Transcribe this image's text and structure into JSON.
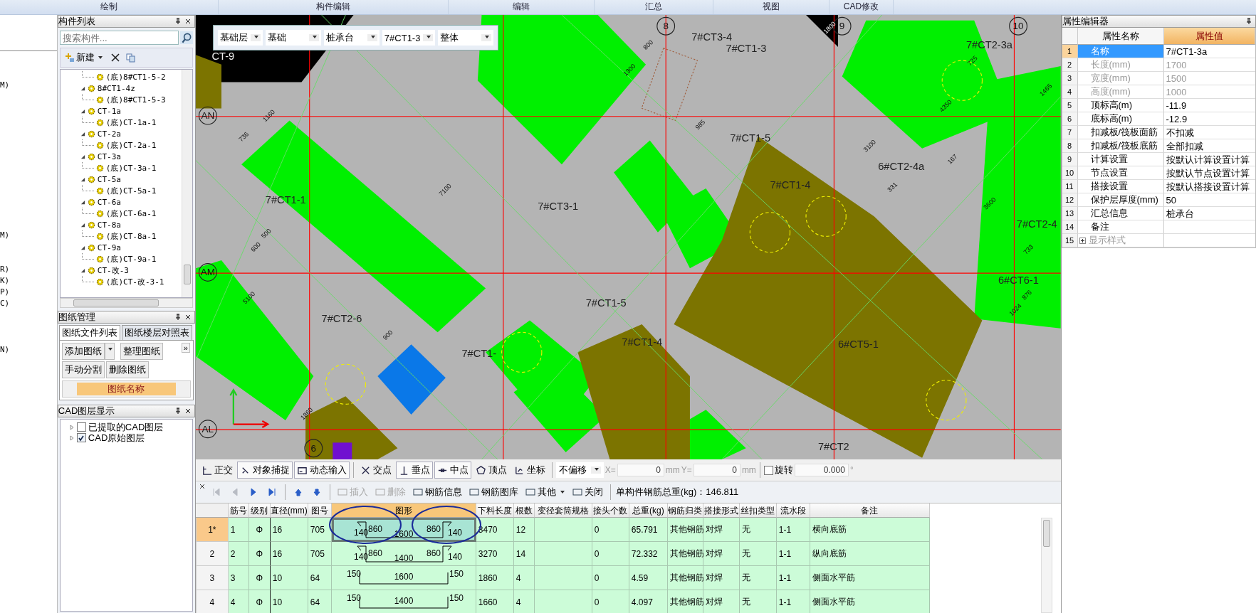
{
  "ribbon_groups": [
    "绘制",
    "构件编辑",
    "编辑",
    "汇总",
    "视图",
    "CAD修改"
  ],
  "left_edge_fragments": [
    "M)",
    "M)",
    "R)",
    "K)",
    "P)",
    "C)",
    "N)"
  ],
  "component_list": {
    "title": "构件列表",
    "search": {
      "placeholder": "搜索构件..."
    },
    "new_label": "新建",
    "tree_continued": [
      {
        "label": "(底)8#CT1-5-2"
      }
    ],
    "tree": [
      {
        "label": "8#CT1-4z",
        "expanded": true,
        "children": [
          {
            "label": "(底)8#CT1-5-3"
          }
        ]
      },
      {
        "label": "CT-1a",
        "expanded": true,
        "children": [
          {
            "label": "(底)CT-1a-1"
          }
        ]
      },
      {
        "label": "CT-2a",
        "expanded": true,
        "children": [
          {
            "label": "(底)CT-2a-1"
          }
        ]
      },
      {
        "label": "CT-3a",
        "expanded": true,
        "children": [
          {
            "label": "(底)CT-3a-1"
          }
        ]
      },
      {
        "label": "CT-5a",
        "expanded": true,
        "children": [
          {
            "label": "(底)CT-5a-1"
          }
        ]
      },
      {
        "label": "CT-6a",
        "expanded": true,
        "children": [
          {
            "label": "(底)CT-6a-1"
          }
        ]
      },
      {
        "label": "CT-8a",
        "expanded": true,
        "children": [
          {
            "label": "(底)CT-8a-1"
          }
        ]
      },
      {
        "label": "CT-9a",
        "expanded": true,
        "children": [
          {
            "label": "(底)CT-9a-1"
          }
        ]
      },
      {
        "label": "CT-改-3",
        "expanded": true,
        "children": [
          {
            "label": "(底)CT-改-3-1"
          }
        ]
      }
    ]
  },
  "drawing_manager": {
    "title": "图纸管理",
    "tabs": [
      {
        "label": "图纸文件列表",
        "selected": true
      },
      {
        "label": "图纸楼层对照表",
        "selected": false
      }
    ],
    "buttons": [
      "添加图纸",
      "整理图纸",
      "手动分割",
      "删除图纸"
    ],
    "more": "»",
    "column_header": "图纸名称"
  },
  "cad_layers": {
    "title": "CAD图层显示",
    "items": [
      {
        "label": "已提取的CAD图层",
        "checked": false,
        "expanded": false
      },
      {
        "label": "CAD原始图层",
        "checked": true,
        "expanded": false
      }
    ]
  },
  "floor_selector": [
    "基础层",
    "基础",
    "桩承台",
    "7#CT1-3",
    "整体"
  ],
  "canvas": {
    "axis_labels": [
      "8",
      "9",
      "10",
      "AN",
      "AM",
      "AL",
      "6"
    ],
    "component_labels": [
      "CT-9",
      "7#CT3-4",
      "7#CT1-3",
      "7#CT2-3a",
      "7#CT1-5",
      "6#CT2-4a",
      "7#CT1-1",
      "7#CT3-1",
      "7#CT1-4",
      "7#CT2-4",
      "6#CT6-1",
      "7#CT1-5",
      "7#CT2-6",
      "7#CT1-",
      "7#CT1-4",
      "6#CT5-1",
      "7#CT2"
    ],
    "dimension_labels": [
      "1300",
      "800",
      "1800",
      "725",
      "4350",
      "1465",
      "3100",
      "3600",
      "985",
      "5100",
      "7100",
      "736",
      "1160",
      "900",
      "1860",
      "600",
      "500",
      "1024",
      "733",
      "876",
      "331",
      "167"
    ]
  },
  "snap_toolbar": {
    "buttons": [
      {
        "label": "正交",
        "on": false
      },
      {
        "label": "对象捕捉",
        "on": true
      },
      {
        "label": "动态输入",
        "on": true
      },
      {
        "label": "交点",
        "on": false
      },
      {
        "label": "垂点",
        "on": true
      },
      {
        "label": "中点",
        "on": true
      },
      {
        "label": "顶点",
        "on": false
      },
      {
        "label": "坐标",
        "on": false
      }
    ],
    "offset_mode": "不偏移",
    "x_label": "X=",
    "x_value": "0",
    "x_unit": "mm",
    "y_label": "Y=",
    "y_value": "0",
    "y_unit": "mm",
    "rotate": {
      "label": "旋转",
      "checked": false
    },
    "angle": "0.000",
    "angle_unit": "°"
  },
  "rebar_toolbar": {
    "nav": [
      {
        "kind": "first",
        "disabled": true
      },
      {
        "kind": "prev",
        "disabled": true
      },
      {
        "kind": "next",
        "disabled": false
      },
      {
        "kind": "last",
        "disabled": false
      },
      {
        "kind": "up",
        "disabled": false
      },
      {
        "kind": "down",
        "disabled": false
      }
    ],
    "items": [
      {
        "label": "插入",
        "disabled": true,
        "dropdown": false
      },
      {
        "label": "删除",
        "disabled": true,
        "dropdown": false
      },
      {
        "label": "钢筋信息",
        "disabled": false,
        "dropdown": false
      },
      {
        "label": "钢筋图库",
        "disabled": false,
        "dropdown": false
      },
      {
        "label": "其他",
        "disabled": false,
        "dropdown": true
      },
      {
        "label": "关闭",
        "disabled": false,
        "dropdown": false
      }
    ],
    "total_weight": "单构件钢筋总重(kg)：146.811"
  },
  "rebar_table": {
    "columns": [
      "筋号",
      "级别",
      "直径(mm)",
      "图号",
      "图形",
      "下料长度",
      "根数",
      "变径套筒规格",
      "接头个数",
      "总重(kg)",
      "钢筋归类",
      "搭接形式",
      "丝扣类型",
      "流水段",
      "备注"
    ],
    "rows": [
      {
        "row_header": "1*",
        "selected": true,
        "cells": [
          "1",
          "Φ",
          "16",
          "705",
          {
            "kind": "hooked",
            "labels": [
              "140",
              "860",
              "1600",
              "860",
              "140"
            ]
          },
          "3470",
          "12",
          "",
          "0",
          "65.791",
          "其他钢筋",
          "对焊",
          "无",
          "1-1",
          "横向底筋"
        ]
      },
      {
        "row_header": "2",
        "selected": false,
        "cells": [
          "2",
          "Φ",
          "16",
          "705",
          {
            "kind": "hooked",
            "labels": [
              "140",
              "860",
              "1400",
              "860",
              "140"
            ]
          },
          "3270",
          "14",
          "",
          "0",
          "72.332",
          "其他钢筋",
          "对焊",
          "无",
          "1-1",
          "纵向底筋"
        ]
      },
      {
        "row_header": "3",
        "selected": false,
        "cells": [
          "3",
          "Φ",
          "10",
          "64",
          {
            "kind": "channel",
            "labels": [
              "150",
              "1600",
              "150"
            ]
          },
          "1860",
          "4",
          "",
          "0",
          "4.59",
          "其他钢筋",
          "对焊",
          "无",
          "1-1",
          "侧面水平筋"
        ]
      },
      {
        "row_header": "4",
        "selected": false,
        "cells": [
          "4",
          "Φ",
          "10",
          "64",
          {
            "kind": "channel",
            "labels": [
              "150",
              "1400",
              "150"
            ]
          },
          "1660",
          "4",
          "",
          "0",
          "4.097",
          "其他钢筋",
          "对焊",
          "无",
          "1-1",
          "侧面水平筋"
        ]
      }
    ]
  },
  "property_editor": {
    "title": "属性编辑器",
    "columns": [
      "属性名称",
      "属性值"
    ],
    "rows": [
      {
        "index": "1",
        "name": "名称",
        "value": "7#CT1-3a",
        "selected": true,
        "readonly": false
      },
      {
        "index": "2",
        "name": "长度(mm)",
        "value": "1700",
        "selected": false,
        "readonly": true
      },
      {
        "index": "3",
        "name": "宽度(mm)",
        "value": "1500",
        "selected": false,
        "readonly": true
      },
      {
        "index": "4",
        "name": "高度(mm)",
        "value": "1000",
        "selected": false,
        "readonly": true
      },
      {
        "index": "5",
        "name": "顶标高(m)",
        "value": "-11.9",
        "selected": false,
        "readonly": false
      },
      {
        "index": "6",
        "name": "底标高(m)",
        "value": "-12.9",
        "selected": false,
        "readonly": false
      },
      {
        "index": "7",
        "name": "扣减板/筏板面筋",
        "value": "不扣减",
        "selected": false,
        "readonly": false
      },
      {
        "index": "8",
        "name": "扣减板/筏板底筋",
        "value": "全部扣减",
        "selected": false,
        "readonly": false
      },
      {
        "index": "9",
        "name": "计算设置",
        "value": "按默认计算设置计算",
        "selected": false,
        "readonly": false
      },
      {
        "index": "10",
        "name": "节点设置",
        "value": "按默认节点设置计算",
        "selected": false,
        "readonly": false
      },
      {
        "index": "11",
        "name": "搭接设置",
        "value": "按默认搭接设置计算",
        "selected": false,
        "readonly": false
      },
      {
        "index": "12",
        "name": "保护层厚度(mm)",
        "value": "50",
        "selected": false,
        "readonly": false
      },
      {
        "index": "13",
        "name": "汇总信息",
        "value": "桩承台",
        "selected": false,
        "readonly": false
      },
      {
        "index": "14",
        "name": "备注",
        "value": "",
        "selected": false,
        "readonly": false
      },
      {
        "index": "15",
        "name": "显示样式",
        "value": "",
        "selected": false,
        "readonly": true,
        "expandable": true
      }
    ]
  }
}
